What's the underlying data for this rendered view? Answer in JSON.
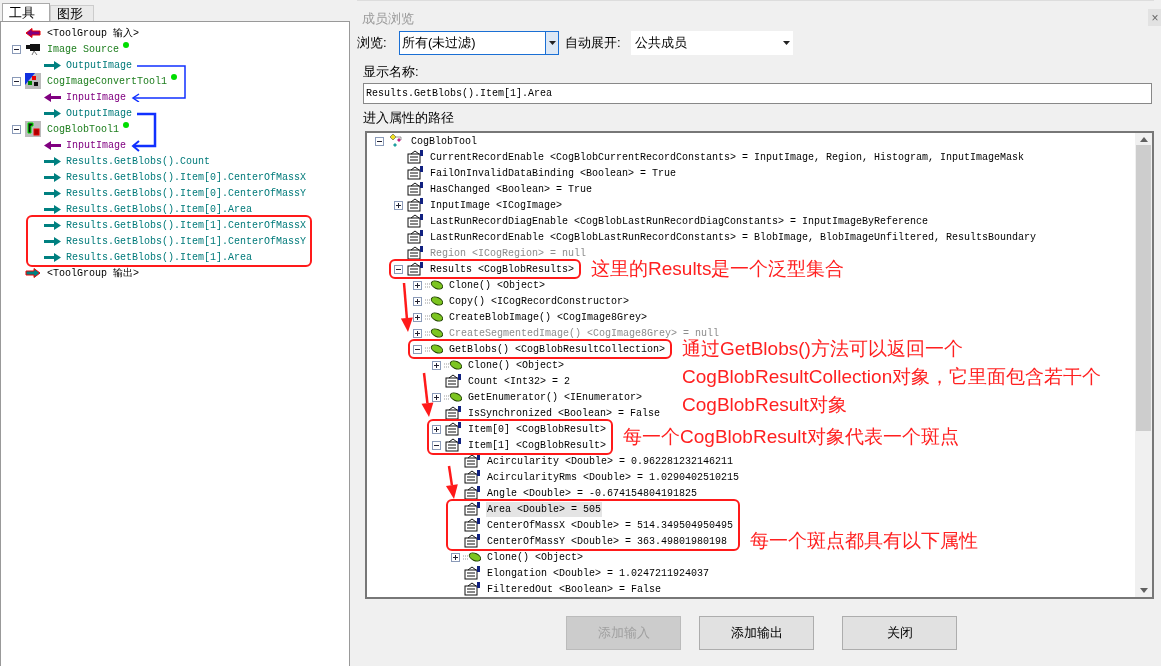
{
  "tool_tabs": [
    {
      "label": "工具",
      "selected": true
    },
    {
      "label": "图形",
      "selected": false
    }
  ],
  "tool_tree": [
    {
      "kind": "group-input",
      "label": "<ToolGroup 输入>"
    },
    {
      "kind": "tool",
      "label": "Image Source",
      "expanded": true,
      "color": "#00dd00",
      "children": [
        {
          "kind": "output",
          "label": "OutputImage"
        }
      ]
    },
    {
      "kind": "tool",
      "label": "CogImageConvertTool1",
      "expanded": true,
      "color": "#00dd00",
      "children": [
        {
          "kind": "input",
          "label": "InputImage"
        },
        {
          "kind": "output",
          "label": "OutputImage"
        }
      ]
    },
    {
      "kind": "tool",
      "label": "CogBlobTool1",
      "expanded": true,
      "color": "#00dd00",
      "children": [
        {
          "kind": "input",
          "label": "InputImage"
        },
        {
          "kind": "output",
          "label": "Results.GetBlobs().Count"
        },
        {
          "kind": "output",
          "label": "Results.GetBlobs().Item[0].CenterOfMassX"
        },
        {
          "kind": "output",
          "label": "Results.GetBlobs().Item[0].CenterOfMassY"
        },
        {
          "kind": "output",
          "label": "Results.GetBlobs().Item[0].Area"
        },
        {
          "kind": "highlight",
          "children": [
            {
              "kind": "output",
              "label": "Results.GetBlobs().Item[1].CenterOfMassX"
            },
            {
              "kind": "output",
              "label": "Results.GetBlobs().Item[1].CenterOfMassY"
            },
            {
              "kind": "output",
              "label": "Results.GetBlobs().Item[1].Area"
            }
          ]
        }
      ]
    },
    {
      "kind": "group-output",
      "label": "<ToolGroup 输出>"
    }
  ],
  "dialog": {
    "title": "成员浏览",
    "close": "×",
    "browse_label": "浏览:",
    "browse_value": "所有(未过滤)",
    "browse_focused": true,
    "expand_label": "自动展开:",
    "expand_value": "公共成员",
    "display_name_label": "显示名称:",
    "display_name": "Results.GetBlobs().Item[1].Area",
    "path_label": "进入属性的路径",
    "tree": [
      {
        "kind": "root",
        "label": "CogBlobTool",
        "expanded": true,
        "selected": false,
        "disabled": false,
        "children": [
          {
            "kind": "property",
            "label": "CurrentRecordEnable <CogBlobCurrentRecordConstants> = InputImage, Region, Histogram, InputImageMask",
            "selected": false,
            "disabled": false
          },
          {
            "kind": "property",
            "label": "FailOnInvalidDataBinding <Boolean> = True",
            "selected": false,
            "disabled": false
          },
          {
            "kind": "property",
            "label": "HasChanged <Boolean> = True",
            "selected": false,
            "disabled": false
          },
          {
            "kind": "property",
            "label": "InputImage <ICogImage>",
            "expanded": false,
            "selected": false,
            "disabled": false
          },
          {
            "kind": "property",
            "label": "LastRunRecordDiagEnable <CogBlobLastRunRecordDiagConstants> = InputImageByReference",
            "selected": false,
            "disabled": false
          },
          {
            "kind": "property",
            "label": "LastRunRecordEnable <CogBlobLastRunRecordConstants> = BlobImage, BlobImageUnfiltered, ResultsBoundary",
            "selected": false,
            "disabled": false
          },
          {
            "kind": "property",
            "label": "Region <ICogRegion> = null",
            "selected": false,
            "disabled": true
          },
          {
            "kind": "highlight",
            "note": "这里的Results是一个泛型集合",
            "children": [
              {
                "kind": "property",
                "label": "Results <CogBlobResults>",
                "expanded": true,
                "selected": false,
                "disabled": false,
                "children": [
                  {
                    "kind": "method",
                    "label": "Clone() <Object>",
                    "expanded": false,
                    "selected": false,
                    "disabled": false
                  },
                  {
                    "kind": "method",
                    "label": "Copy() <ICogRecordConstructor>",
                    "expanded": false,
                    "selected": false,
                    "disabled": false
                  },
                  {
                    "kind": "method",
                    "label": "CreateBlobImage() <CogImage8Grey>",
                    "expanded": false,
                    "selected": false,
                    "disabled": false
                  },
                  {
                    "kind": "method",
                    "label": "CreateSegmentedImage() <CogImage8Grey> = null",
                    "expanded": false,
                    "selected": false,
                    "disabled": true
                  },
                  {
                    "kind": "highlight",
                    "note": "通过GetBlobs()方法可以返回一个CogBlobResultCollection对象，它里面包含若干个CogBlobResult对象",
                    "children": [
                      {
                        "kind": "method",
                        "label": "GetBlobs() <CogBlobResultCollection>",
                        "expanded": true,
                        "selected": false,
                        "disabled": false,
                        "children": [
                          {
                            "kind": "method",
                            "label": "Clone() <Object>",
                            "expanded": false,
                            "selected": false,
                            "disabled": false
                          },
                          {
                            "kind": "property",
                            "label": "Count <Int32> = 2",
                            "selected": false,
                            "disabled": false
                          },
                          {
                            "kind": "method",
                            "label": "GetEnumerator() <IEnumerator>",
                            "expanded": false,
                            "selected": false,
                            "disabled": false
                          },
                          {
                            "kind": "property",
                            "label": "IsSynchronized <Boolean> = False",
                            "selected": false,
                            "disabled": false
                          },
                          {
                            "kind": "highlight",
                            "note": "每一个CogBlobResult对象代表一个斑点",
                            "children": [
                              {
                                "kind": "property",
                                "label": "Item[0] <CogBlobResult>",
                                "expanded": false,
                                "selected": false,
                                "disabled": false
                              },
                              {
                                "kind": "property",
                                "label": "Item[1] <CogBlobResult>",
                                "expanded": true,
                                "selected": false,
                                "disabled": false,
                                "children": [
                                  {
                                    "kind": "property",
                                    "label": "Acircularity <Double> = 0.962281232146211",
                                    "selected": false,
                                    "disabled": false
                                  },
                                  {
                                    "kind": "property",
                                    "label": "AcircularityRms <Double> = 1.0290402510215",
                                    "selected": false,
                                    "disabled": false
                                  },
                                  {
                                    "kind": "property",
                                    "label": "Angle <Double> = -0.674154804191825",
                                    "selected": false,
                                    "disabled": false
                                  },
                                  {
                                    "kind": "highlight",
                                    "note": "每一个斑点都具有以下属性",
                                    "children": [
                                      {
                                        "kind": "property",
                                        "label": "Area <Double> = 505",
                                        "selected": true,
                                        "disabled": false
                                      },
                                      {
                                        "kind": "property",
                                        "label": "CenterOfMassX <Double> = 514.349504950495",
                                        "selected": false,
                                        "disabled": false
                                      },
                                      {
                                        "kind": "property",
                                        "label": "CenterOfMassY <Double> = 363.49801980198",
                                        "selected": false,
                                        "disabled": false
                                      }
                                    ]
                                  },
                                  {
                                    "kind": "method",
                                    "label": "Clone() <Object>",
                                    "expanded": false,
                                    "selected": false,
                                    "disabled": false
                                  },
                                  {
                                    "kind": "property",
                                    "label": "Elongation <Double> = 1.0247211924037",
                                    "selected": false,
                                    "disabled": false
                                  },
                                  {
                                    "kind": "property",
                                    "label": "FilteredOut <Boolean> = False",
                                    "selected": false,
                                    "disabled": false
                                  }
                                ]
                              }
                            ]
                          }
                        ]
                      }
                    ]
                  }
                ]
              }
            ]
          }
        ]
      }
    ],
    "buttons": [
      {
        "label": "添加输入",
        "disabled": true
      },
      {
        "label": "添加输出",
        "disabled": false
      },
      {
        "label": "关闭",
        "disabled": false
      }
    ]
  }
}
